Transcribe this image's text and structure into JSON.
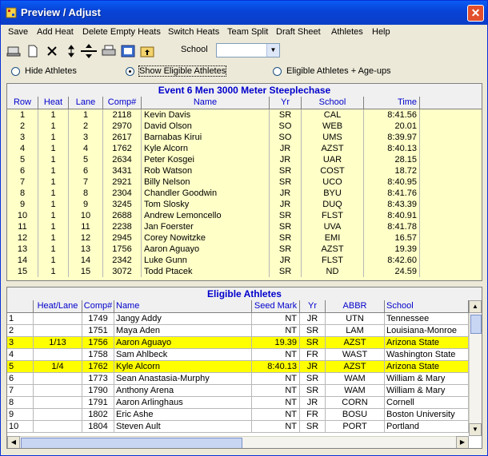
{
  "window": {
    "title": "Preview / Adjust"
  },
  "menu": [
    "Save",
    "Add Heat",
    "Delete Empty Heats",
    "Switch Heats",
    "Team Split",
    "Draft Sheet",
    "Athletes",
    "Help"
  ],
  "toolbar": {
    "icons": [
      "keyboard-icon",
      "new-page-icon",
      "delete-x-icon",
      "up-down-arrows-icon",
      "sort-icon",
      "print-icon",
      "report-icon",
      "folder-up-icon"
    ],
    "school_label": "School",
    "school_value": ""
  },
  "filters": {
    "hide": "Hide Athletes",
    "show": "Show Eligible Athletes",
    "ageups": "Eligible Athletes + Age-ups",
    "selected": "show"
  },
  "event": {
    "title": "Event 6  Men 3000 Meter Steeplechase",
    "headers": [
      "Row",
      "Heat",
      "Lane",
      "Comp#",
      "Name",
      "Yr",
      "School",
      "Time"
    ],
    "rows": [
      [
        "1",
        "1",
        "1",
        "2118",
        "Kevin Davis",
        "SR",
        "CAL",
        "8:41.56"
      ],
      [
        "2",
        "1",
        "2",
        "2970",
        "David Olson",
        "SO",
        "WEB",
        "20.01"
      ],
      [
        "3",
        "1",
        "3",
        "2617",
        "Barnabas Kirui",
        "SO",
        "UMS",
        "8:39.97"
      ],
      [
        "4",
        "1",
        "4",
        "1762",
        "Kyle Alcorn",
        "JR",
        "AZST",
        "8:40.13"
      ],
      [
        "5",
        "1",
        "5",
        "2634",
        "Peter Kosgei",
        "JR",
        "UAR",
        "28.15"
      ],
      [
        "6",
        "1",
        "6",
        "3431",
        "Rob Watson",
        "SR",
        "COST",
        "18.72"
      ],
      [
        "7",
        "1",
        "7",
        "2921",
        "Billy Nelson",
        "SR",
        "UCO",
        "8:40.95"
      ],
      [
        "8",
        "1",
        "8",
        "2304",
        "Chandler Goodwin",
        "JR",
        "BYU",
        "8:41.76"
      ],
      [
        "9",
        "1",
        "9",
        "3245",
        "Tom Slosky",
        "JR",
        "DUQ",
        "8:43.39"
      ],
      [
        "10",
        "1",
        "10",
        "2688",
        "Andrew Lemoncello",
        "SR",
        "FLST",
        "8:40.91"
      ],
      [
        "11",
        "1",
        "11",
        "2238",
        "Jan Foerster",
        "SR",
        "UVA",
        "8:41.78"
      ],
      [
        "12",
        "1",
        "12",
        "2945",
        "Corey Nowitzke",
        "SR",
        "EMI",
        "16.57"
      ],
      [
        "13",
        "1",
        "13",
        "1756",
        "Aaron Aguayo",
        "SR",
        "AZST",
        "19.39"
      ],
      [
        "14",
        "1",
        "14",
        "2342",
        "Luke Gunn",
        "JR",
        "FLST",
        "8:42.60"
      ],
      [
        "15",
        "1",
        "15",
        "3072",
        "Todd Ptacek",
        "SR",
        "ND",
        "24.59"
      ]
    ]
  },
  "eligible": {
    "title": "Eligible Athletes",
    "headers": [
      "",
      "Heat/Lane",
      "Comp#",
      "Name",
      "Seed Mark",
      "Yr",
      "ABBR",
      "School"
    ],
    "rows": [
      [
        "1",
        "",
        "1749",
        "Jangy Addy",
        "NT",
        "JR",
        "UTN",
        "Tennessee"
      ],
      [
        "2",
        "",
        "1751",
        "Maya Aden",
        "NT",
        "SR",
        "LAM",
        "Louisiana-Monroe"
      ],
      [
        "3",
        "1/13",
        "1756",
        "Aaron Aguayo",
        "19.39",
        "SR",
        "AZST",
        "Arizona State"
      ],
      [
        "4",
        "",
        "1758",
        "Sam Ahlbeck",
        "NT",
        "FR",
        "WAST",
        "Washington State"
      ],
      [
        "5",
        "1/4",
        "1762",
        "Kyle Alcorn",
        "8:40.13",
        "JR",
        "AZST",
        "Arizona State"
      ],
      [
        "6",
        "",
        "1773",
        "Sean Anastasia-Murphy",
        "NT",
        "SR",
        "WAM",
        "William & Mary"
      ],
      [
        "7",
        "",
        "1790",
        "Anthony Arena",
        "NT",
        "SR",
        "WAM",
        "William & Mary"
      ],
      [
        "8",
        "",
        "1791",
        "Aaron Arlinghaus",
        "NT",
        "JR",
        "CORN",
        "Cornell"
      ],
      [
        "9",
        "",
        "1802",
        "Eric Ashe",
        "NT",
        "FR",
        "BOSU",
        "Boston University"
      ],
      [
        "10",
        "",
        "1804",
        "Steven Ault",
        "NT",
        "SR",
        "PORT",
        "Portland"
      ]
    ],
    "highlight_rows": [
      "3",
      "5"
    ]
  },
  "colors": {
    "event_bg": "#ffffc8",
    "highlight": "#ffff00",
    "header_text": "#0000cc",
    "titlebar": "#0a46d6"
  }
}
